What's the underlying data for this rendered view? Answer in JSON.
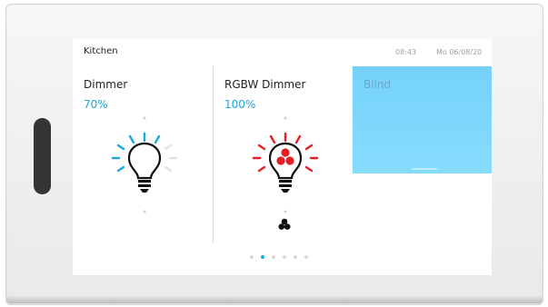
{
  "header": {
    "room": "Kitchen",
    "time": "08:43",
    "date": "Mo 06/08/20"
  },
  "tiles": [
    {
      "title": "Dimmer",
      "value": "70%",
      "icon": "lightbulb-icon",
      "accent": "#1aa8e0"
    },
    {
      "title": "RGBW Dimmer",
      "value": "100%",
      "icon": "rgb-lightbulb-icon",
      "accent": "#e31e24"
    },
    {
      "title": "Blind",
      "icon": "blind-position",
      "accent": "#78d4fb"
    }
  ],
  "pager": {
    "page_count": 6,
    "active_page": 2
  },
  "colors": {
    "accent_blue": "#1aa8e0",
    "rgb_red": "#e31e24",
    "blind_blue": "#78d4fb",
    "handle": "#353535"
  }
}
